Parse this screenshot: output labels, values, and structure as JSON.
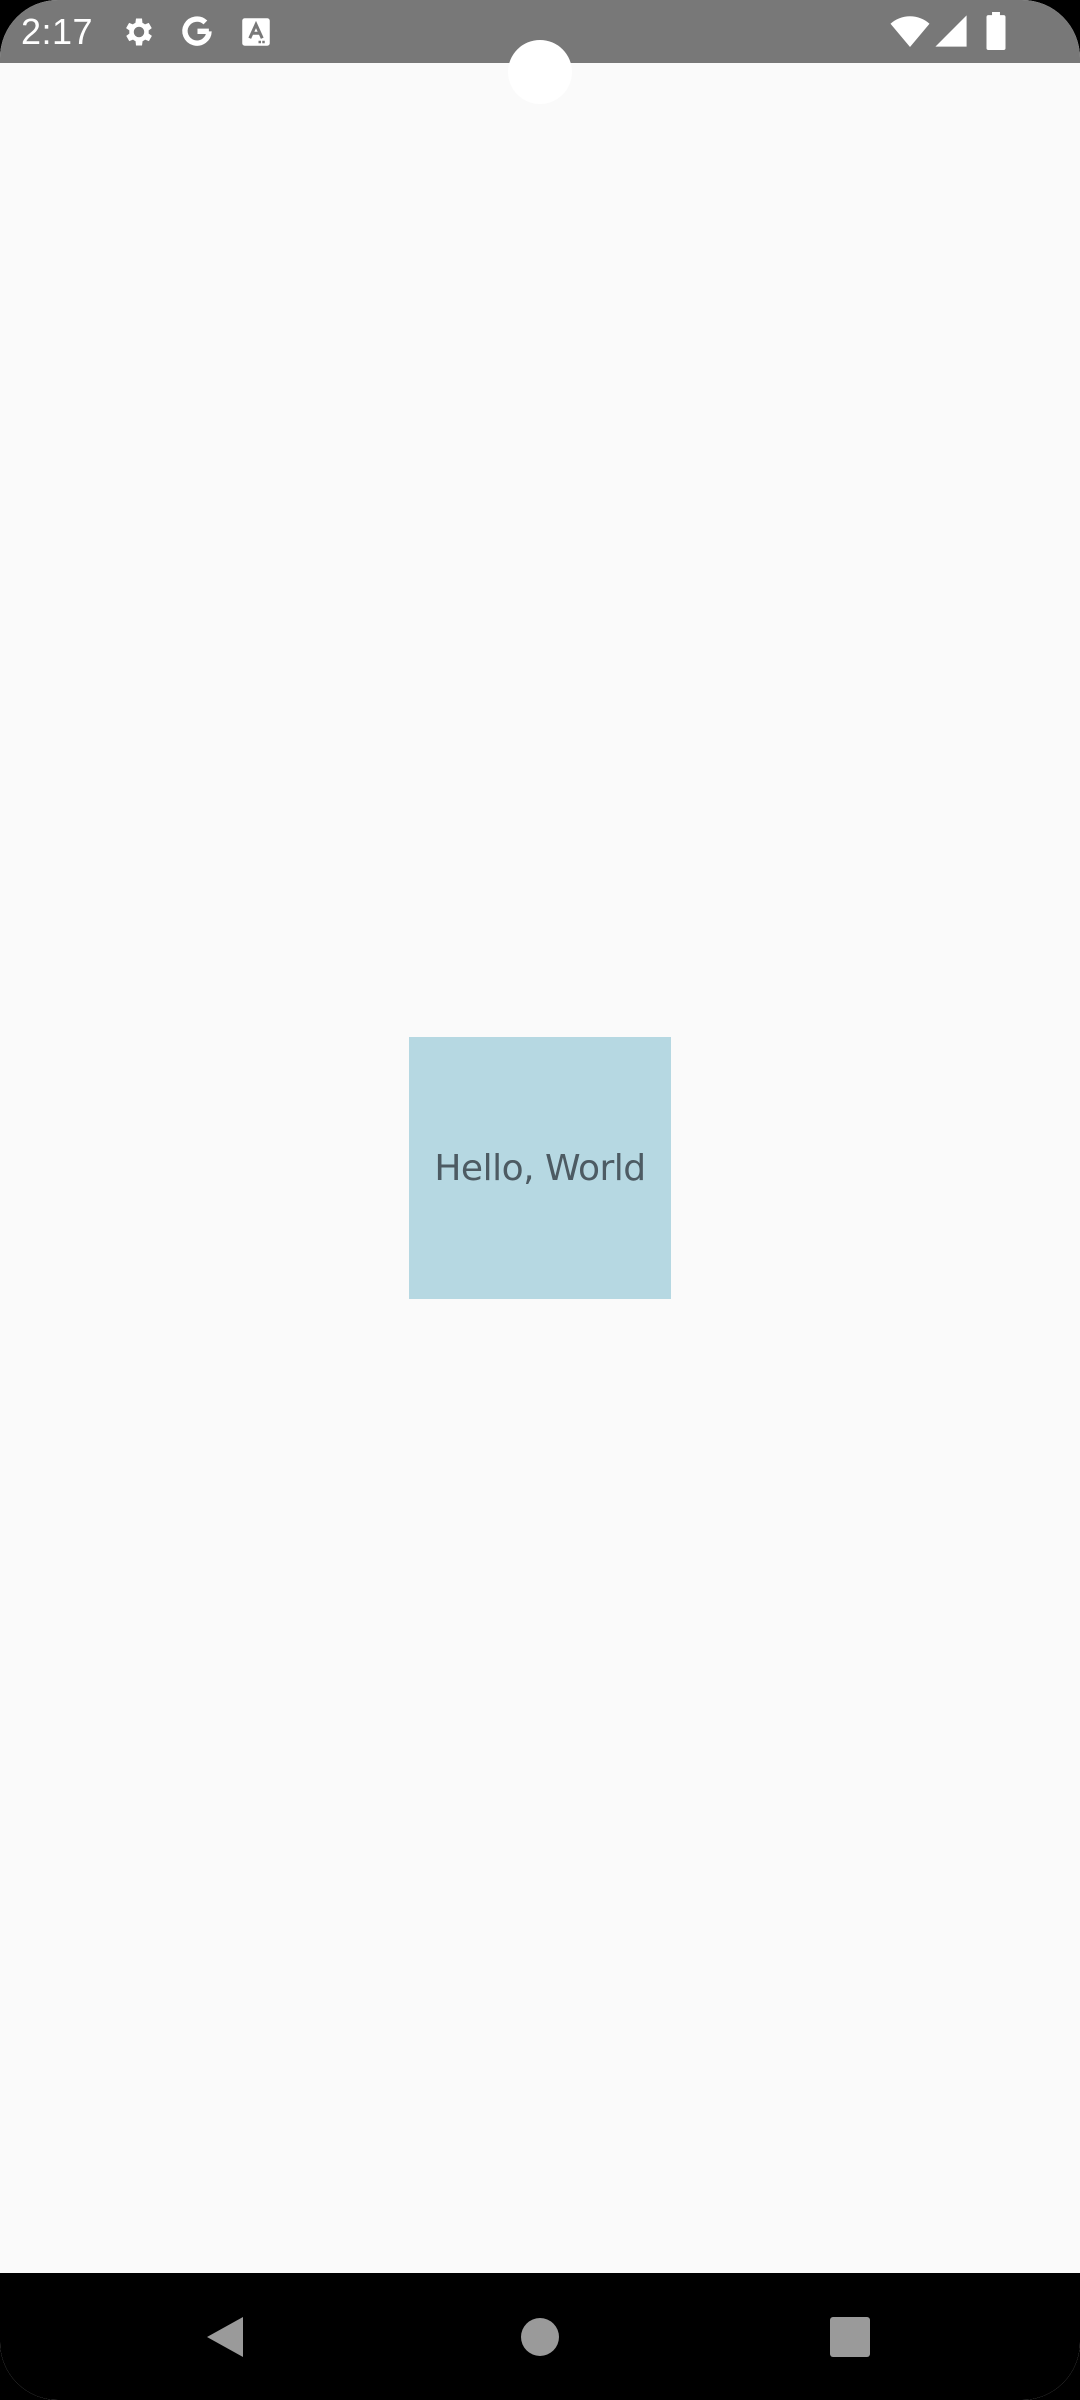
{
  "status_bar": {
    "time": "2:17",
    "left_icons": [
      "gear-icon",
      "google-g-icon",
      "text-a-icon"
    ],
    "right_icons": [
      "wifi-icon",
      "cell-signal-icon",
      "battery-icon"
    ],
    "background": "#787878"
  },
  "main": {
    "hello_text": "Hello, World",
    "box_color": "#b6d8e2",
    "background": "#fafafa"
  },
  "nav_bar": {
    "buttons": [
      "back-icon",
      "home-icon",
      "recents-icon"
    ],
    "background": "#000000"
  }
}
